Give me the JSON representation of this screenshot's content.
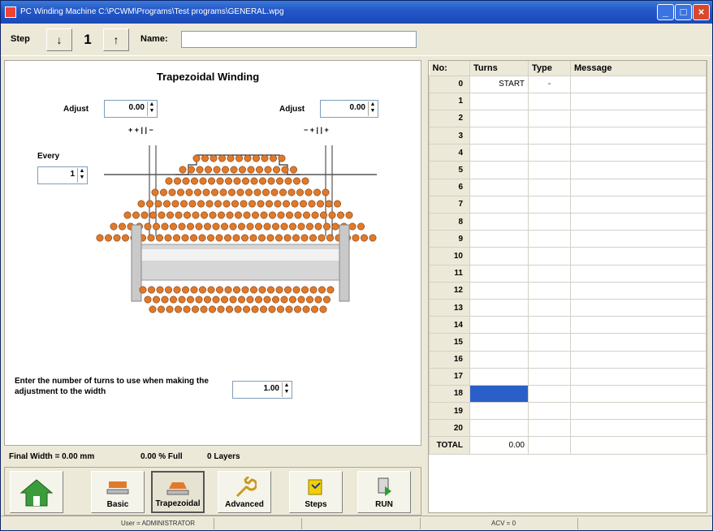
{
  "window": {
    "title": "PC Winding Machine  C:\\PCWM\\Programs\\Test programs\\GENERAL.wpg"
  },
  "stepbar": {
    "step_label": "Step",
    "down_arrow": "↓",
    "up_arrow": "↑",
    "step_value": "1",
    "name_label": "Name:",
    "name_value": ""
  },
  "left": {
    "title": "Trapezoidal Winding",
    "adjust_left_label": "Adjust",
    "adjust_left_value": "0.00",
    "adjust_right_label": "Adjust",
    "adjust_right_value": "0.00",
    "every_label": "Every",
    "every_value": "1",
    "instruction": "Enter the number of turns to use when making the adjustment to the width",
    "turns_value": "1.00",
    "left_markers": "+ + | | −",
    "right_markers": "− + | | +"
  },
  "status": {
    "final_width": "Final Width = 0.00 mm",
    "percent_full": "0.00 % Full",
    "layers": "0 Layers"
  },
  "toolbar": {
    "home_label": "",
    "basic_label": "Basic",
    "trapezoidal_label": "Trapezoidal",
    "advanced_label": "Advanced",
    "steps_label": "Steps",
    "run_label": "RUN"
  },
  "grid": {
    "headers": {
      "no": "No:",
      "turns": "Turns",
      "type": "Type",
      "message": "Message"
    },
    "rows": [
      {
        "no": "0",
        "turns": "START",
        "type": "-",
        "message": ""
      },
      {
        "no": "1",
        "turns": "",
        "type": "",
        "message": ""
      },
      {
        "no": "2",
        "turns": "",
        "type": "",
        "message": ""
      },
      {
        "no": "3",
        "turns": "",
        "type": "",
        "message": ""
      },
      {
        "no": "4",
        "turns": "",
        "type": "",
        "message": ""
      },
      {
        "no": "5",
        "turns": "",
        "type": "",
        "message": ""
      },
      {
        "no": "6",
        "turns": "",
        "type": "",
        "message": ""
      },
      {
        "no": "7",
        "turns": "",
        "type": "",
        "message": ""
      },
      {
        "no": "8",
        "turns": "",
        "type": "",
        "message": ""
      },
      {
        "no": "9",
        "turns": "",
        "type": "",
        "message": ""
      },
      {
        "no": "10",
        "turns": "",
        "type": "",
        "message": ""
      },
      {
        "no": "11",
        "turns": "",
        "type": "",
        "message": ""
      },
      {
        "no": "12",
        "turns": "",
        "type": "",
        "message": ""
      },
      {
        "no": "13",
        "turns": "",
        "type": "",
        "message": ""
      },
      {
        "no": "14",
        "turns": "",
        "type": "",
        "message": ""
      },
      {
        "no": "15",
        "turns": "",
        "type": "",
        "message": ""
      },
      {
        "no": "16",
        "turns": "",
        "type": "",
        "message": ""
      },
      {
        "no": "17",
        "turns": "",
        "type": "",
        "message": ""
      },
      {
        "no": "18",
        "turns": "",
        "type": "",
        "message": ""
      },
      {
        "no": "19",
        "turns": "",
        "type": "",
        "message": ""
      },
      {
        "no": "20",
        "turns": "",
        "type": "",
        "message": ""
      }
    ],
    "total_label": "TOTAL",
    "total_value": "0.00"
  },
  "statusbar": {
    "user": "User = ADMINISTRATOR",
    "acv": "ACV = 0"
  },
  "colors": {
    "accent": "#2a5fc8",
    "wire": "#e07a2a"
  }
}
